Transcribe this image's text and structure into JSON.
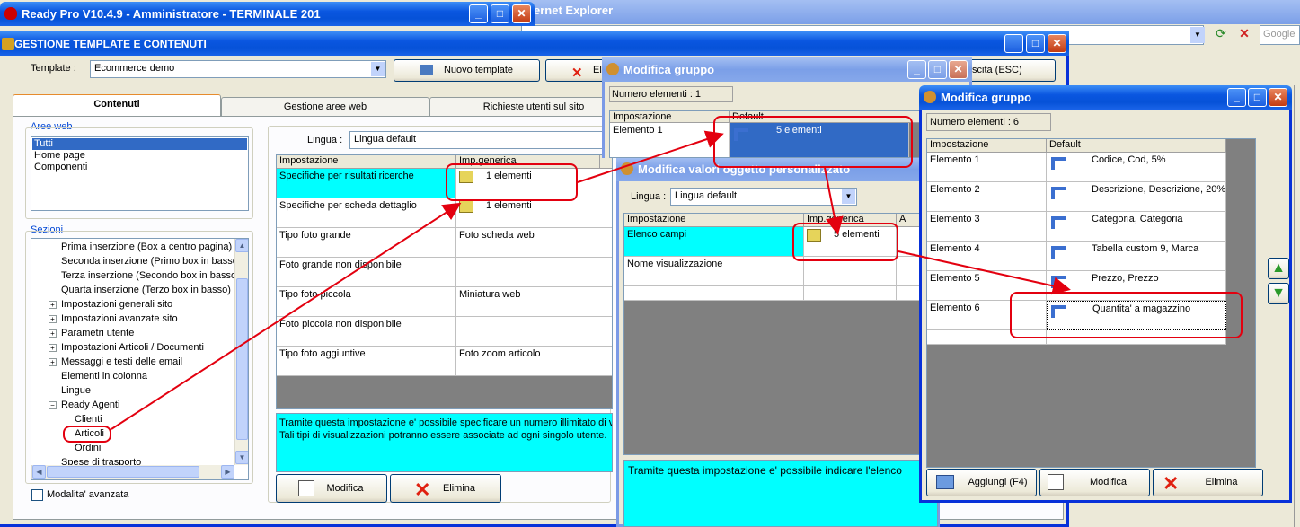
{
  "ready_window": {
    "title": "Ready Pro V10.4.9 - Amministratore - TERMINALE 201"
  },
  "ie_window": {
    "title_fragment": "ernet Explorer",
    "search_placeholder": "Google"
  },
  "gestione": {
    "title": "GESTIONE TEMPLATE E CONTENUTI",
    "template_label": "Template :",
    "template_value": "Ecommerce demo",
    "new_template_button": "Nuovo template",
    "delete_button_fragment": "El",
    "exit_fragment": "scita (ESC)",
    "tabs": [
      "Contenuti",
      "Gestione aree web",
      "Richieste utenti sul sito"
    ],
    "aree_web_label": "Aree web",
    "aree_web_items": [
      "Tutti",
      "Home page",
      "Componenti"
    ],
    "sezioni_label": "Sezioni",
    "sezioni_items": [
      "Prima inserzione (Box a centro pagina)",
      "Seconda inserzione (Primo box in basso)",
      "Terza inserzione (Secondo box in basso)",
      "Quarta inserzione (Terzo box in basso)",
      "Impostazioni generali sito",
      "Impostazioni avanzate sito",
      "Parametri utente",
      "Impostazioni Articoli / Documenti",
      "Messaggi e testi delle email",
      "Elementi in colonna",
      "Lingue",
      "Ready Agenti",
      "Clienti",
      "Articoli",
      "Ordini",
      "Spese di trasporto"
    ],
    "advanced_mode_label": "Modalita' avanzata",
    "lingua_label": "Lingua :",
    "lingua_value": "Lingua default",
    "grid_headers": [
      "Impostazione",
      "Imp.generica"
    ],
    "grid_rows": [
      {
        "name": "Specifiche per risultati ricerche",
        "value": "1 elementi"
      },
      {
        "name": "Specifiche per scheda dettaglio",
        "value": "1 elementi"
      },
      {
        "name": "Tipo foto grande",
        "value": "Foto scheda web"
      },
      {
        "name": "Foto grande non disponibile",
        "value": ""
      },
      {
        "name": "Tipo foto piccola",
        "value": "Miniatura web"
      },
      {
        "name": "Foto piccola non disponibile",
        "value": ""
      },
      {
        "name": "Tipo foto aggiuntive",
        "value": "Foto zoom articolo"
      }
    ],
    "description_line1": "Tramite questa impostazione e' possibile specificare un numero illimitato di v",
    "description_line2": "Tali tipi di visualizzazioni potranno essere associate ad ogni singolo utente.",
    "modify_button": "Modifica",
    "delete_button": "Elimina"
  },
  "modifica_gruppo_1": {
    "title": "Modifica gruppo",
    "count_label": "Numero elementi : 1",
    "headers": [
      "Impostazione",
      "Default"
    ],
    "rows": [
      {
        "name": "Elemento 1",
        "value": "5 elementi"
      }
    ]
  },
  "modifica_valori": {
    "title": "Modifica valori oggetto personalizzato",
    "lingua_label": "Lingua :",
    "lingua_value": "Lingua default",
    "headers": [
      "Impostazione",
      "Imp.generica",
      "A"
    ],
    "rows": [
      {
        "name": "Elenco campi",
        "value": "5 elementi"
      },
      {
        "name": "Nome visualizzazione",
        "value": ""
      }
    ],
    "description": "Tramite questa impostazione e' possibile indicare l'elenco"
  },
  "modifica_gruppo_2": {
    "title": "Modifica gruppo",
    "count_label": "Numero elementi : 6",
    "headers": [
      "Impostazione",
      "Default"
    ],
    "rows": [
      {
        "name": "Elemento 1",
        "value": "Codice, Cod, 5%"
      },
      {
        "name": "Elemento 2",
        "value": "Descrizione, Descrizione, 20%"
      },
      {
        "name": "Elemento 3",
        "value": "Categoria, Categoria"
      },
      {
        "name": "Elemento 4",
        "value": "Tabella custom 9, Marca"
      },
      {
        "name": "Elemento 5",
        "value": "Prezzo, Prezzo"
      },
      {
        "name": "Elemento 6",
        "value": "Quantita' a magazzino"
      }
    ],
    "add_button": "Aggiungi (F4)",
    "modify_button": "Modifica",
    "delete_button": "Elimina"
  },
  "colors": {
    "xp_blue": "#0a56e0",
    "highlight_cyan": "#00ffff",
    "selection": "#316ac5",
    "annotation_red": "#e3000f"
  }
}
